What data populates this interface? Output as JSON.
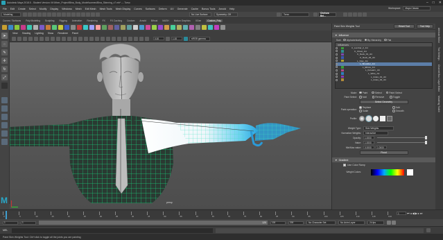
{
  "window": {
    "title": "Autodesk Maya 2018.5 - Student Version: M:\\Mixer_Project\\Bina_Body_Model\\scenes\\Bina_Skinning_v7.mb* --- Torso"
  },
  "menus": [
    "File",
    "Edit",
    "Create",
    "Select",
    "Modify",
    "Display",
    "Windows",
    "Mesh",
    "Edit Mesh",
    "Mesh Tools",
    "Mesh Display",
    "Curves",
    "Surfaces",
    "Deform",
    "UV",
    "Generate",
    "Cache",
    "Bonus Tools",
    "Arnold",
    "Help"
  ],
  "workspace": {
    "label": "Workspace:",
    "value": "Maya Classic"
  },
  "status": {
    "mode": "Modeling",
    "live_surface": "No Live Surface",
    "symmetry": "Symmetry: Off",
    "search_value": "Torso",
    "user": "Chelsea Bel..."
  },
  "shelf_tabs": [
    "Curves / Surfaces",
    "Poly Modeling",
    "Sculpting",
    "Rigging",
    "Animation",
    "Rendering",
    "FX",
    "FX Caching",
    "Custom",
    "Arnold",
    "Bifrost",
    "MASH",
    "Motion Graphics",
    "XGen",
    "Custom_Poly"
  ],
  "shelf_active": "Custom_Poly",
  "viewport": {
    "menu": [
      "View",
      "Shading",
      "Lighting",
      "Show",
      "Renderer",
      "Panel"
    ],
    "field_a": "0.00",
    "field_b": "1.00",
    "color_space": "sRGB gamma",
    "camera_label": "persp"
  },
  "panel": {
    "title": "Paint Skin Weights Tool",
    "reset_label": "Reset Tool",
    "help_label": "Tool Help",
    "influence_header": "Influence",
    "sort_label": "Sort:",
    "sort_options": [
      "Alphabetically",
      "By Hierarchy",
      "Flat"
    ],
    "sort_selected": 1,
    "influences_label": "Influences",
    "influences": [
      {
        "name": "C_Lumbar_2_Jnt",
        "indent": 0,
        "color": "#3a9a3a"
      },
      {
        "name": "C_Chest_Jnt",
        "indent": 1,
        "color": "#2f8f8f"
      },
      {
        "name": "C_Neck_01_Jnt",
        "indent": 2,
        "color": "#7a4ab0"
      },
      {
        "name": "C_Neck_02_Jnt",
        "indent": 3,
        "color": "#3a5ab0"
      },
      {
        "name": "L_Clav_Jnt",
        "indent": 2,
        "color": "#b0a030"
      },
      {
        "name": "L_Shoulder_Jnt",
        "indent": 3,
        "color": "#5c7ea8",
        "selected": true
      },
      {
        "name": "L_Elbow_Jnt",
        "indent": 4,
        "color": "#3a9a3a"
      },
      {
        "name": "L_Forearm_Jnt",
        "indent": 5,
        "color": "#b04a8a"
      },
      {
        "name": "L_Wrist_Jnt",
        "indent": 6,
        "color": "#2f7fbf"
      },
      {
        "name": "L_Index_01_Jnt",
        "indent": 7,
        "color": "#8a3ab0"
      },
      {
        "name": "L_Index_02_Jnt",
        "indent": 7,
        "color": "#b08a3a"
      }
    ],
    "mode_label": "Mode:",
    "mode_options": [
      "Paint",
      "Select",
      "Paint Select"
    ],
    "mode_selected": 0,
    "paint_select_label": "Paint Select:",
    "paint_select_options": [
      "Add",
      "Remove",
      "Toggle"
    ],
    "select_geometry": "Select Geometry",
    "paint_op_label": "Paint operation:",
    "paint_ops": [
      "Replace",
      "Add",
      "Scale",
      "Smooth"
    ],
    "paint_op_selected": 0,
    "profile_label": "Profile:",
    "weight_type_label": "Weight Type:",
    "weight_type": "Skin Weights",
    "normalize_label": "Normalize Weights:",
    "normalize": "Interactive",
    "opacity_label": "Opacity:",
    "opacity": "1.0000",
    "opacity_frac": 1.0,
    "value_label": "Value:",
    "value": "1.0000",
    "value_frac": 1.0,
    "minmax_label": "Min/Max value:",
    "min_value": "0.0000",
    "max_value": "1.0000",
    "flood_label": "Flood",
    "gradient_header": "Gradient",
    "use_color_ramp": "Use Color Ramp",
    "weight_colors_label": "Weight Colors:"
  },
  "side_tabs": [
    "Attribute Editor",
    "Tool Settings",
    "Channel Box / Layer Editor",
    "Modeling Toolkit"
  ],
  "timeline": {
    "ticks": [
      "0",
      "5",
      "10",
      "15",
      "20",
      "25",
      "30",
      "35",
      "40",
      "45",
      "50",
      "55",
      "60",
      "65",
      "70",
      "75",
      "80",
      "85",
      "90",
      "95",
      "100",
      "105",
      "110",
      "115",
      "120"
    ],
    "current_frame": "1"
  },
  "range": {
    "start": "1",
    "inner_start": "1",
    "inner_end": "120",
    "end_a": "100",
    "end_b": "200",
    "character_set": "No Character Set",
    "anim_layer": "No Anim Layer",
    "fps": "24 fps"
  },
  "cmd": {
    "label": "MEL"
  },
  "help_line": "Paint Skin Weights Tool: Ctrl+click to toggle all the joints you are painting"
}
